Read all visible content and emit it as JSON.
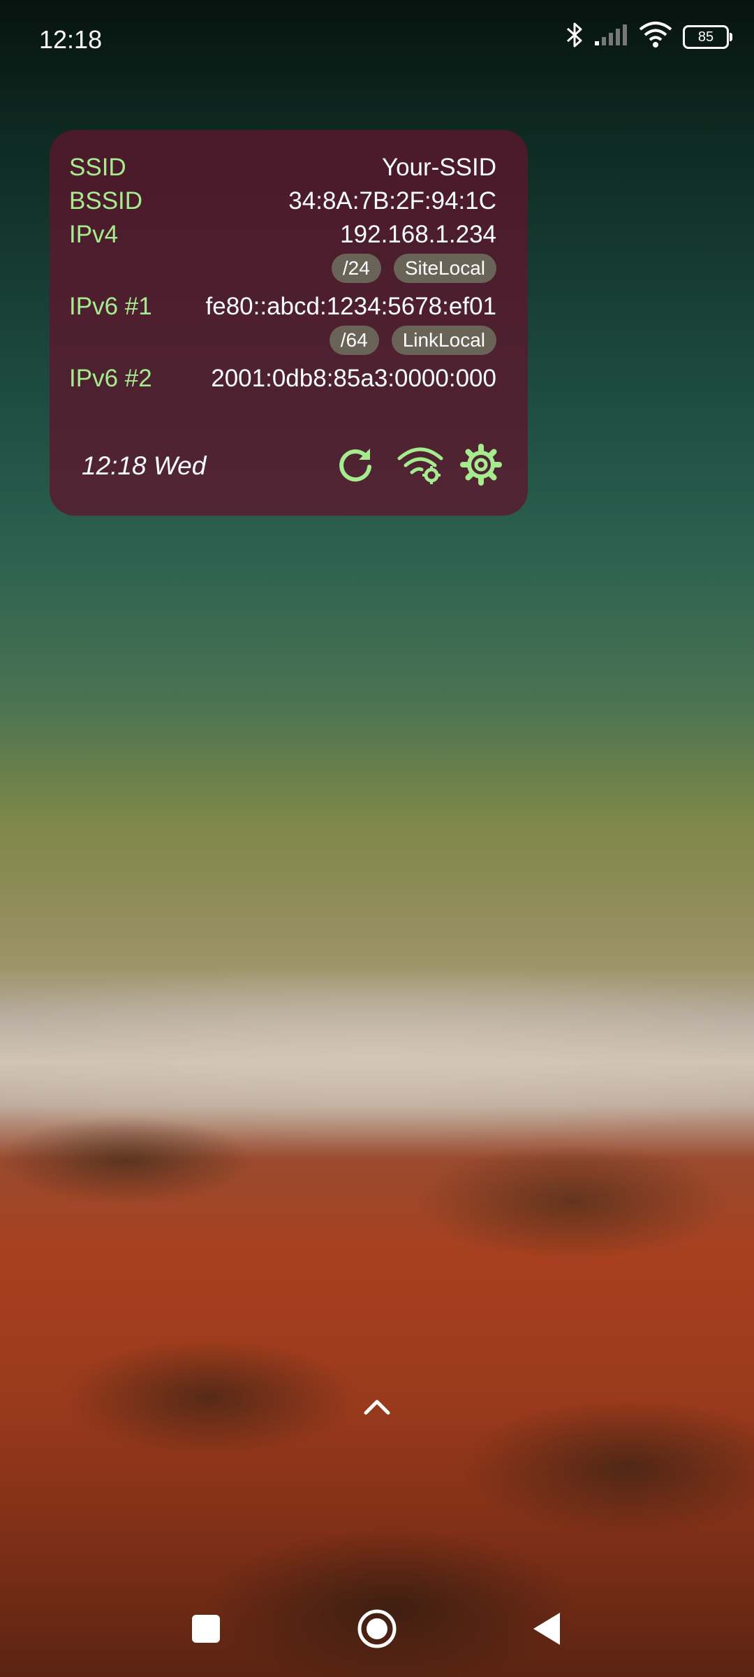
{
  "status_bar": {
    "time": "12:18",
    "battery_level": "85",
    "icons": [
      "bluetooth-icon",
      "cellular-signal-icon",
      "wifi-icon",
      "battery-icon"
    ]
  },
  "widget": {
    "rows": [
      {
        "label": "SSID",
        "value": "Your-SSID"
      },
      {
        "label": "BSSID",
        "value": "34:8A:7B:2F:94:1C"
      },
      {
        "label": "IPv4",
        "value": "192.168.1.234",
        "chips": [
          "/24",
          "SiteLocal"
        ]
      },
      {
        "label": "IPv6 #1",
        "value": "fe80::abcd:1234:5678:ef01",
        "chips": [
          "/64",
          "LinkLocal"
        ]
      },
      {
        "label": "IPv6 #2",
        "value": "2001:0db8:85a3:0000:000"
      }
    ],
    "clock": "12:18 Wed",
    "actions": [
      "refresh-icon",
      "wifi-settings-icon",
      "gear-icon"
    ],
    "colors": {
      "background": "#5c162d",
      "label": "#a6ec8f",
      "chip": "#6a6458"
    }
  },
  "navigation": {
    "buttons": [
      "recents-button",
      "home-button",
      "back-button"
    ]
  }
}
